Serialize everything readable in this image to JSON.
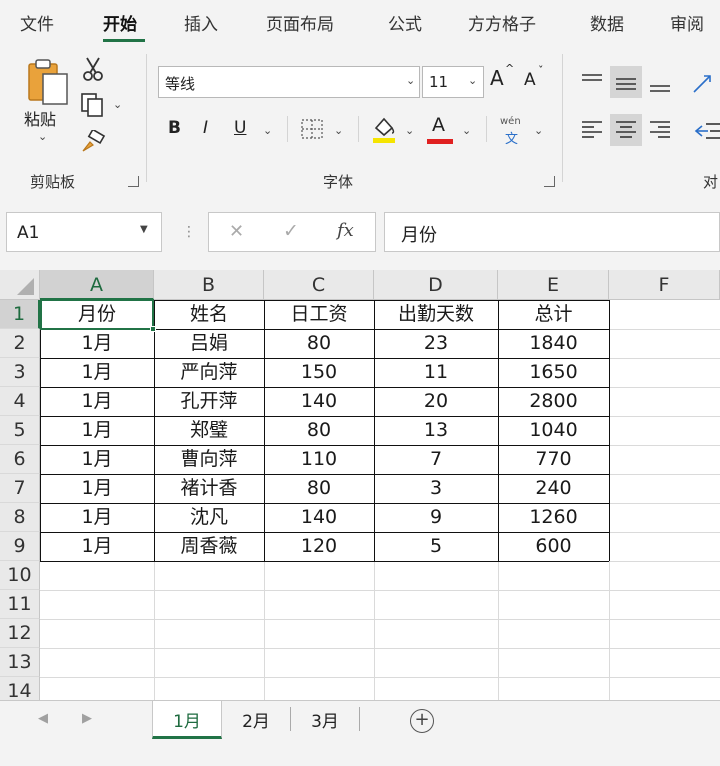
{
  "ribbon_tabs": [
    "文件",
    "开始",
    "插入",
    "页面布局",
    "公式",
    "方方格子",
    "数据",
    "审阅"
  ],
  "active_tab": "开始",
  "clipboard": {
    "paste_label": "粘贴",
    "group_label": "剪贴板"
  },
  "font": {
    "name": "等线",
    "size": "11",
    "group_label": "字体",
    "bold": "B",
    "italic": "I",
    "underline": "U",
    "font_color_glyph": "A",
    "phonetic_top": "wén",
    "phonetic_bottom": "文",
    "grow_glyph": "A",
    "shrink_glyph": "A",
    "highlight_color": "#f5e400",
    "font_color": "#e02020"
  },
  "alignment": {
    "group_label_partial": "对"
  },
  "formula_bar": {
    "name_box": "A1",
    "cancel": "✕",
    "enter": "✓",
    "fx": "fx",
    "formula": "月份"
  },
  "sheet": {
    "columns": [
      "A",
      "B",
      "C",
      "D",
      "E",
      "F"
    ],
    "rows": [
      "1",
      "2",
      "3",
      "4",
      "5",
      "6",
      "7",
      "8",
      "9",
      "10",
      "11",
      "12",
      "13",
      "14"
    ],
    "selected_cell": "A1",
    "headers": [
      "月份",
      "姓名",
      "日工资",
      "出勤天数",
      "总计"
    ],
    "data": [
      [
        "1月",
        "吕娟",
        "80",
        "23",
        "1840"
      ],
      [
        "1月",
        "严向萍",
        "150",
        "11",
        "1650"
      ],
      [
        "1月",
        "孔开萍",
        "140",
        "20",
        "2800"
      ],
      [
        "1月",
        "郑璧",
        "80",
        "13",
        "1040"
      ],
      [
        "1月",
        "曹向萍",
        "110",
        "7",
        "770"
      ],
      [
        "1月",
        "褚计香",
        "80",
        "3",
        "240"
      ],
      [
        "1月",
        "沈凡",
        "140",
        "9",
        "1260"
      ],
      [
        "1月",
        "周香薇",
        "120",
        "5",
        "600"
      ]
    ]
  },
  "sheet_tabs": [
    "1月",
    "2月",
    "3月"
  ],
  "active_sheet": "1月",
  "colors": {
    "accent": "#217346",
    "ribbon_bg": "#f3f3f3"
  }
}
